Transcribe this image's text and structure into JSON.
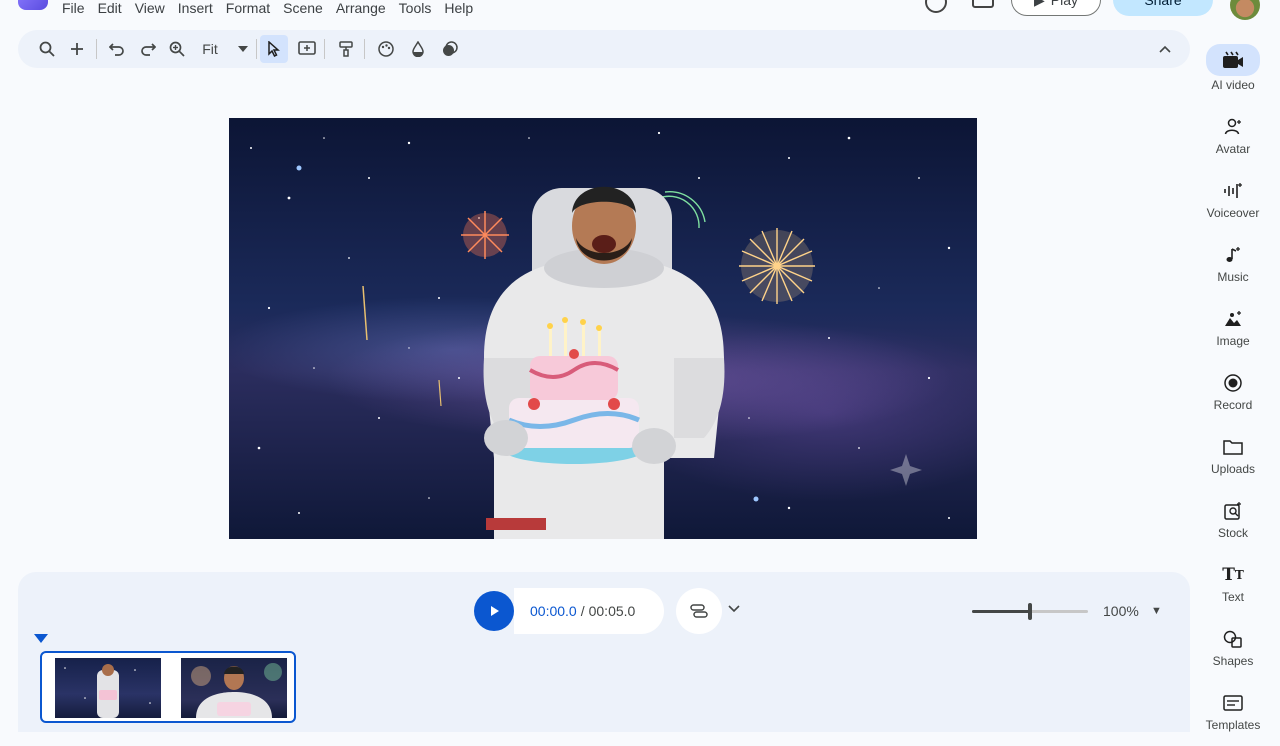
{
  "menu": {
    "items": [
      "File",
      "Edit",
      "View",
      "Insert",
      "Format",
      "Scene",
      "Arrange",
      "Tools",
      "Help"
    ]
  },
  "header": {
    "play_label": "Play",
    "share_label": "Share"
  },
  "toolbar": {
    "zoom_label": "Fit"
  },
  "sidebar": {
    "items": [
      {
        "label": "AI video",
        "icon": "ai-video-icon"
      },
      {
        "label": "Avatar",
        "icon": "avatar-icon"
      },
      {
        "label": "Voiceover",
        "icon": "voiceover-icon"
      },
      {
        "label": "Music",
        "icon": "music-icon"
      },
      {
        "label": "Image",
        "icon": "image-icon"
      },
      {
        "label": "Record",
        "icon": "record-icon"
      },
      {
        "label": "Uploads",
        "icon": "folder-icon"
      },
      {
        "label": "Stock",
        "icon": "stock-icon"
      },
      {
        "label": "Text",
        "icon": "text-icon"
      },
      {
        "label": "Shapes",
        "icon": "shapes-icon"
      },
      {
        "label": "Templates",
        "icon": "templates-icon"
      }
    ]
  },
  "playback": {
    "current_time": "00:00.0",
    "separator": "/",
    "total_time": "00:05.0",
    "zoom_percent": "100%",
    "zoom_level": 0.5
  },
  "colors": {
    "accent": "#0b57d0",
    "share_bg": "#c2e7ff",
    "toolbar_bg": "#edf2fa"
  }
}
